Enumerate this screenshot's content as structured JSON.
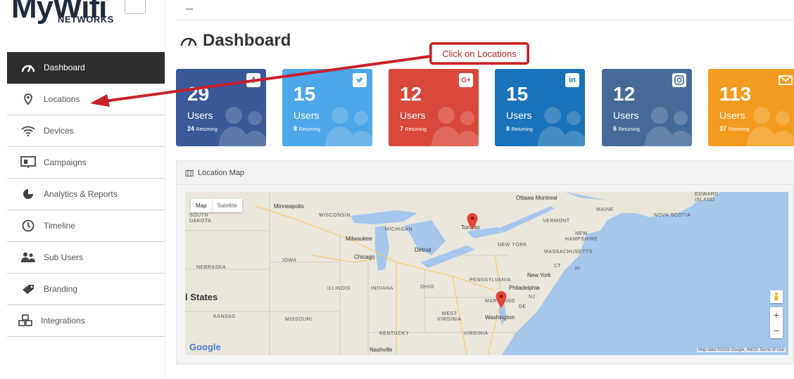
{
  "app": {
    "logo_text": "MyWifi",
    "logo_sub": "NETWORKS"
  },
  "sidebar": {
    "items": [
      {
        "label": "Dashboard",
        "icon": "dashboard-gauge-icon",
        "active": true
      },
      {
        "label": "Locations",
        "icon": "map-pin-icon",
        "active": false
      },
      {
        "label": "Devices",
        "icon": "wifi-icon",
        "active": false
      },
      {
        "label": "Campaigns",
        "icon": "campaign-screen-icon",
        "active": false
      },
      {
        "label": "Analytics & Reports",
        "icon": "pie-chart-icon",
        "active": false
      },
      {
        "label": "Timeline",
        "icon": "clock-icon",
        "active": false
      },
      {
        "label": "Sub Users",
        "icon": "users-icon",
        "active": false
      },
      {
        "label": "Branding",
        "icon": "tag-icon",
        "active": false
      },
      {
        "label": "Integrations",
        "icon": "cubes-icon",
        "active": false
      }
    ]
  },
  "main": {
    "title": "Dashboard"
  },
  "callout": {
    "text": "Click on Locations",
    "color": "#c9202a"
  },
  "cards": [
    {
      "count": "29",
      "label": "Users",
      "returning": "24",
      "returning_label": "Returning",
      "network": "facebook",
      "icon": "facebook-icon",
      "color": "#3b5998"
    },
    {
      "count": "15",
      "label": "Users",
      "returning": "8",
      "returning_label": "Returning",
      "network": "twitter",
      "icon": "twitter-icon",
      "color": "#4da7e8"
    },
    {
      "count": "12",
      "label": "Users",
      "returning": "7",
      "returning_label": "Returning",
      "network": "google-plus",
      "icon": "google-plus-icon",
      "color": "#d9483b"
    },
    {
      "count": "15",
      "label": "Users",
      "returning": "8",
      "returning_label": "Returning",
      "network": "linkedin",
      "icon": "linkedin-icon",
      "color": "#1a73b8"
    },
    {
      "count": "12",
      "label": "Users",
      "returning": "6",
      "returning_label": "Returning",
      "network": "instagram",
      "icon": "instagram-icon",
      "color": "#456a98"
    },
    {
      "count": "113",
      "label": "Users",
      "returning": "37",
      "returning_label": "Returning",
      "network": "email",
      "icon": "envelope-icon",
      "color": "#f39b1e"
    }
  ],
  "map_panel": {
    "title": "Location Map",
    "toggle": {
      "map": "Map",
      "satellite": "Satellite"
    },
    "labels": {
      "ottawa_montreal": "Ottawa  Montreal",
      "edward_island": "EDWARD\nISLAND",
      "minneapolis": "Minneapolis",
      "south_dakota": "SOUTH\nDAKOTA",
      "wisconsin": "WISCONSIN",
      "maine": "MAINE",
      "nova_scotia": "NOVA SCOTIA",
      "vermont": "VERMONT",
      "michigan": "MICHIGAN",
      "toronto": "Toronto",
      "new_hampshire": "NEW\nHAMPSHIRE",
      "milwaukee": "Milwaukee",
      "detroit": "Detroit",
      "new_york_state": "NEW YORK",
      "massachusetts": "MASSACHUSETTS",
      "nebraska": "NEBRASKA",
      "iowa": "IOWA",
      "chicago": "Chicago",
      "ct": "CT",
      "ri": "RI",
      "new_york_city": "New York",
      "pennsylvania": "PENNSYLVANIA",
      "illinois": "ILLINOIS",
      "indiana": "INDIANA",
      "ohio": "OHIO",
      "philadelphia": "Philadelphia",
      "nj": "NJ",
      "united_states": "l States",
      "maryland": "MARYLAND",
      "de": "DE",
      "kansas": "KANSAS",
      "missouri": "MISSOURI",
      "west_virginia": "WEST\nVIRGINIA",
      "washington": "Washington",
      "kentucky": "KENTUCKY",
      "virginia": "VIRGINIA",
      "nashville": "Nashville"
    },
    "google": "Google",
    "attribution": "Map data ©2016 Google, INEGI    Terms of Use",
    "zoom_in": "+",
    "zoom_out": "−"
  }
}
